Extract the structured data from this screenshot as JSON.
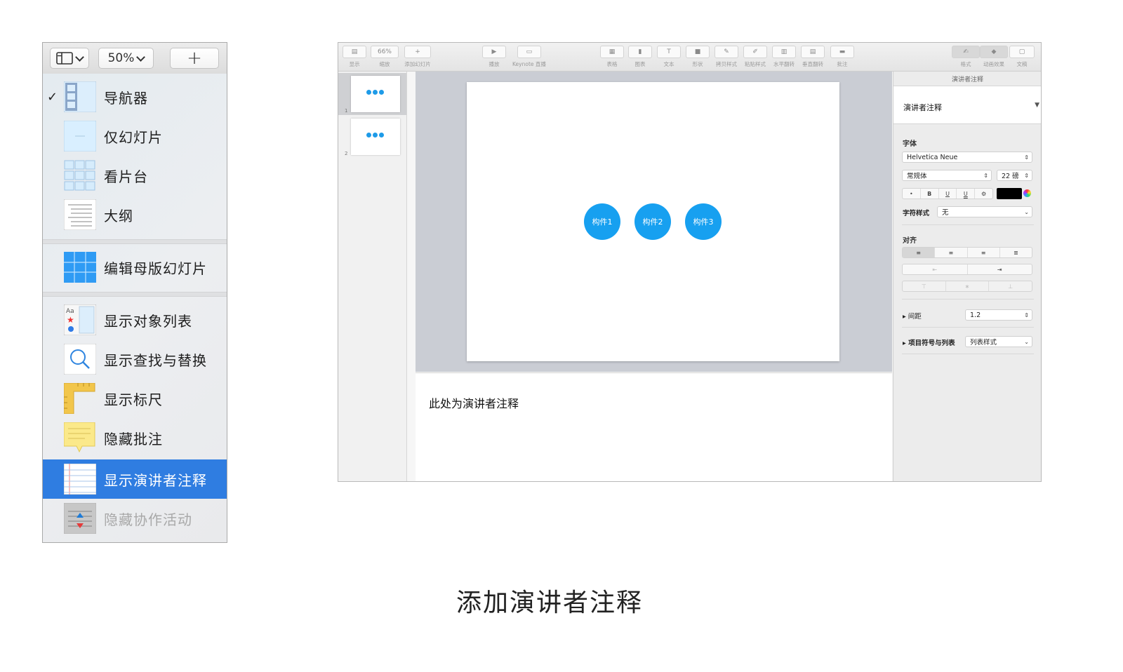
{
  "menu": {
    "zoom_label": "50%",
    "add_label": "+",
    "items": [
      {
        "label": "导航器",
        "checked": true,
        "icon": "navigator-icon"
      },
      {
        "label": "仅幻灯片",
        "checked": false,
        "icon": "slide-only-icon"
      },
      {
        "label": "看片台",
        "checked": false,
        "icon": "light-table-icon"
      },
      {
        "label": "大纲",
        "checked": false,
        "icon": "outline-icon"
      },
      {
        "label": "编辑母版幻灯片",
        "checked": false,
        "icon": "master-slides-icon"
      },
      {
        "label": "显示对象列表",
        "checked": false,
        "icon": "object-list-icon"
      },
      {
        "label": "显示查找与替换",
        "checked": false,
        "icon": "magnifier-icon"
      },
      {
        "label": "显示标尺",
        "checked": false,
        "icon": "ruler-icon"
      },
      {
        "label": "隐藏批注",
        "checked": false,
        "icon": "sticky-note-icon"
      },
      {
        "label": "显示演讲者注释",
        "checked": false,
        "selected": true,
        "icon": "presenter-notes-icon"
      },
      {
        "label": "隐藏协作活动",
        "checked": false,
        "disabled": true,
        "icon": "collaboration-icon"
      }
    ],
    "check_glyph": "✓",
    "colors": {
      "selected_bg": "#2f7de1"
    }
  },
  "keynote": {
    "toolbar": [
      {
        "label": "显示",
        "glyph": "▤"
      },
      {
        "label": "缩放",
        "glyph": "66%"
      },
      {
        "label": "添加幻灯片",
        "glyph": "+"
      },
      {
        "label": "播放",
        "glyph": "▶"
      },
      {
        "label": "Keynote 直播",
        "glyph": "▭"
      },
      {
        "label": "表格",
        "glyph": "▦"
      },
      {
        "label": "图表",
        "glyph": "▮"
      },
      {
        "label": "文本",
        "glyph": "T"
      },
      {
        "label": "形状",
        "glyph": "■"
      },
      {
        "label": "拷贝样式",
        "glyph": "✎"
      },
      {
        "label": "粘贴样式",
        "glyph": "✐"
      },
      {
        "label": "水平翻转",
        "glyph": "▥"
      },
      {
        "label": "垂直翻转",
        "glyph": "▤"
      },
      {
        "label": "批注",
        "glyph": "▬"
      },
      {
        "label": "格式",
        "glyph": "✍"
      },
      {
        "label": "动画效果",
        "glyph": "◆"
      },
      {
        "label": "文稿",
        "glyph": "▢"
      }
    ],
    "slides": [
      {
        "number": "1"
      },
      {
        "number": "2"
      }
    ],
    "builds": [
      "构件1",
      "构件2",
      "构件3"
    ],
    "notes_text": "此处为演讲者注释",
    "inspector": {
      "tab": "演讲者注释",
      "paragraph_style": "演讲者注释",
      "font_heading": "字体",
      "font_family": "Helvetica Neue",
      "font_weight": "常规体",
      "font_size": "22 磅",
      "style_buttons": [
        "•",
        "B",
        "U",
        "U",
        "⚙"
      ],
      "char_style_label": "字符样式",
      "char_style_value": "无",
      "align_heading": "对齐",
      "spacing_label": "间距",
      "spacing_value": "1.2",
      "bullets_label": "项目符号与列表",
      "bullets_value": "列表样式",
      "colors": {
        "text_color": "#000000"
      }
    },
    "colors": {
      "build_circle": "#17a0f0",
      "canvas_bg": "#cacdd4"
    }
  },
  "caption": "添加演讲者注释"
}
